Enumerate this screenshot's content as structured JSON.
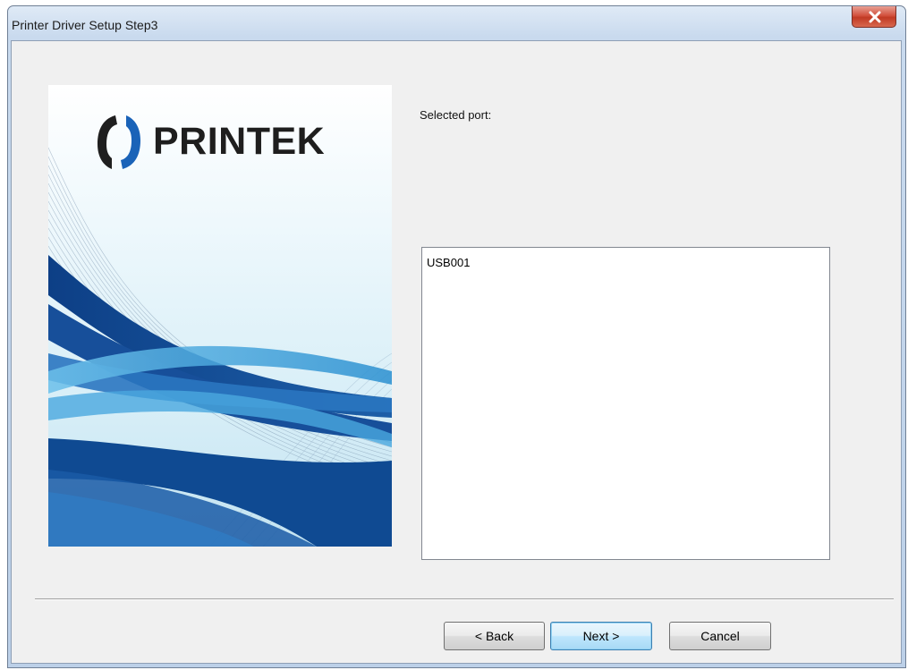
{
  "window": {
    "title": "Printer Driver Setup Step3"
  },
  "titlebar": {
    "close_icon": "close-x-icon"
  },
  "branding": {
    "logo_text": "PRINTEK",
    "logo_icon": "printek-logo-icon"
  },
  "main": {
    "port_label": "Selected port:",
    "ports": [
      "USB001"
    ]
  },
  "buttons": {
    "back_label": "< Back",
    "next_label": "Next >",
    "cancel_label": "Cancel"
  },
  "colors": {
    "brand_blue": "#1a63b8",
    "close_red": "#c13a24",
    "dialog_bg": "#f0f0f0"
  }
}
